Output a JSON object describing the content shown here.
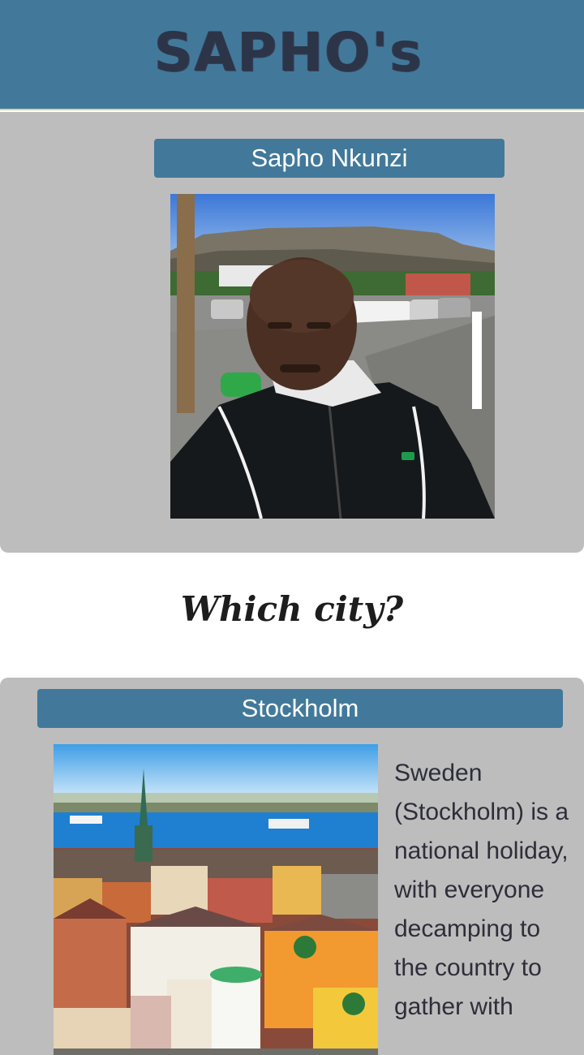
{
  "header": {
    "title": "SAPHO's"
  },
  "profile": {
    "name": "Sapho Nkunzi"
  },
  "section": {
    "heading": "Which city?"
  },
  "city": {
    "name": "Stockholm",
    "description": "Sweden (Stockholm) is a national holiday, with everyone decamping to the country to gather with"
  },
  "colors": {
    "header_bg": "#42799a",
    "card_bg": "#bdbdbd",
    "banner_bg": "#42799a",
    "title_text": "#2c3448"
  }
}
